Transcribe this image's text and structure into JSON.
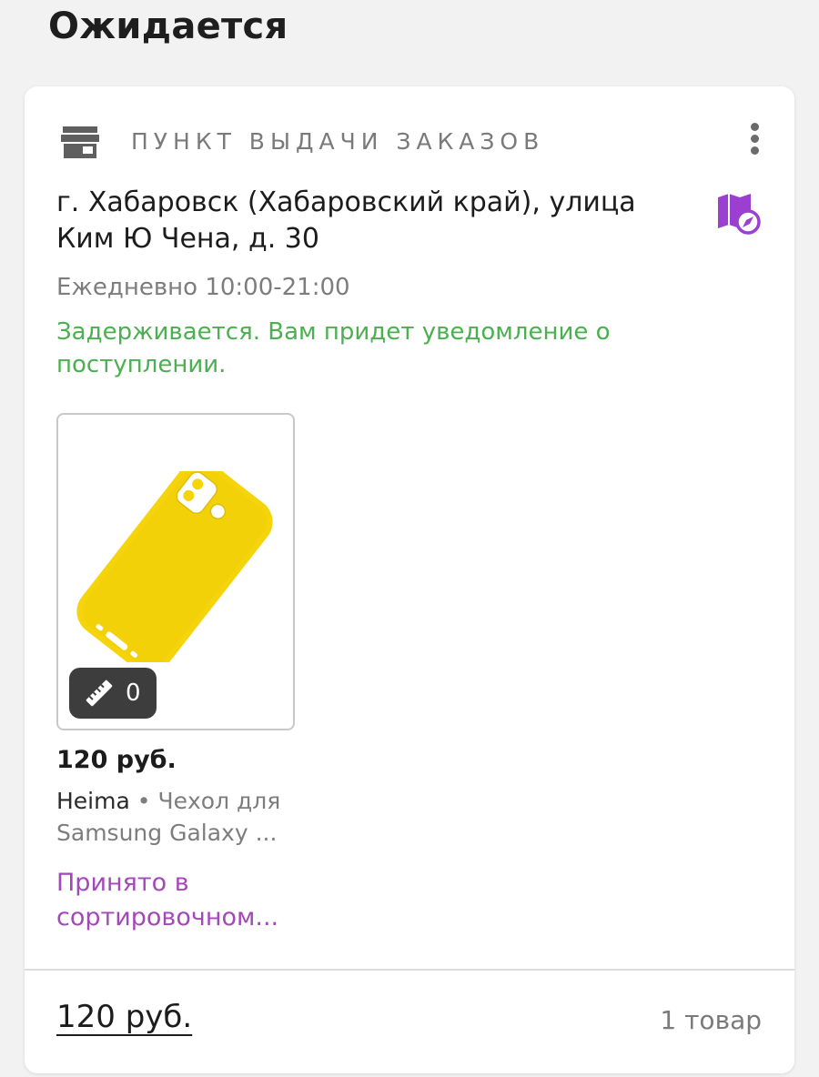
{
  "section": {
    "title": "Ожидается"
  },
  "pickup": {
    "label": "ПУНКТ ВЫДАЧИ ЗАКАЗОВ",
    "address": "г. Хабаровск (Хабаровский край), улица Ким Ю Чена, д. 30",
    "hours": "Ежедневно 10:00-21:00",
    "delay_notice": "Задерживается. Вам придет уведомление о поступлении."
  },
  "product": {
    "size_count": "0",
    "price": "120 руб.",
    "brand": "Heima",
    "separator": "•",
    "name": "Чехол для Samsung Galaxy ...",
    "status": "Принято в сортировочном..."
  },
  "footer": {
    "total": "120 руб.",
    "items_count": "1 товар"
  },
  "icons": {
    "store": "store-icon",
    "more": "more-vertical-icon",
    "map": "map-compass-icon",
    "ruler": "ruler-icon"
  },
  "colors": {
    "accent": "#a348b8",
    "map_icon": "#9b3fd0",
    "delay_text": "#4caf50",
    "product_color": "#f5d40c"
  }
}
